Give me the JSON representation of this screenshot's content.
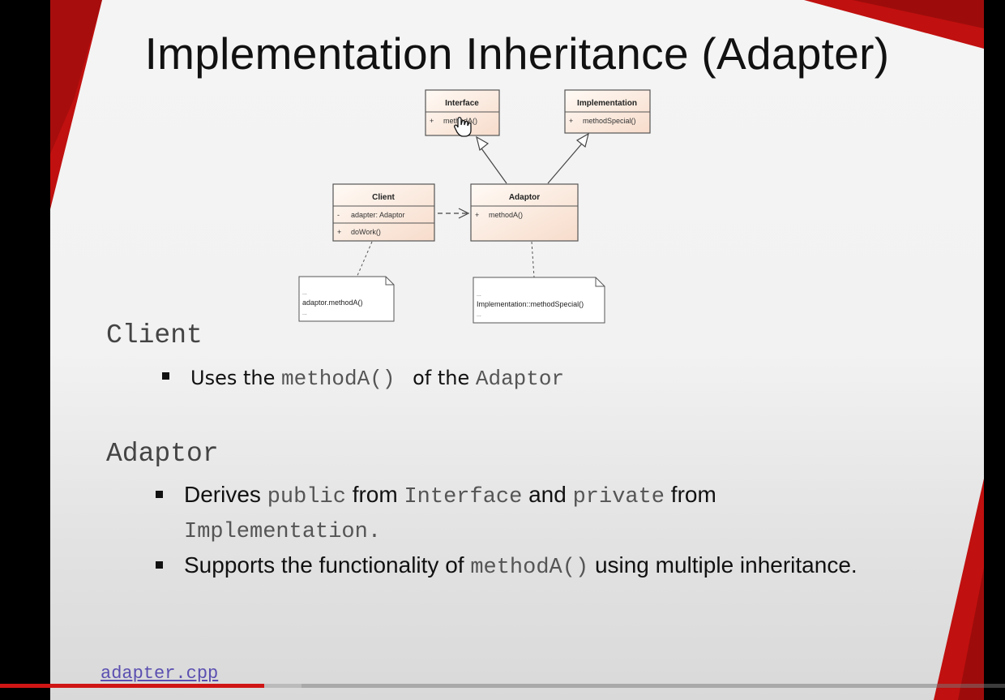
{
  "slide": {
    "title": "Implementation Inheritance (Adapter)",
    "colors": {
      "accent": "#c0100f",
      "text": "#111111",
      "mono": "#555555"
    }
  },
  "diagram": {
    "classes": {
      "interface": {
        "name": "Interface",
        "members": [
          {
            "vis": "+",
            "text": "methodA()"
          }
        ]
      },
      "implementation": {
        "name": "Implementation",
        "members": [
          {
            "vis": "+",
            "text": "methodSpecial()"
          }
        ]
      },
      "client": {
        "name": "Client",
        "attributes": [
          {
            "vis": "-",
            "text": "adapter: Adaptor"
          }
        ],
        "methods": [
          {
            "vis": "+",
            "text": "doWork()"
          }
        ]
      },
      "adaptor": {
        "name": "Adaptor",
        "members": [
          {
            "vis": "+",
            "text": "methodA()"
          }
        ]
      }
    },
    "notes": {
      "client_note": {
        "pre": "...",
        "line": "adaptor.methodA()",
        "post": "..."
      },
      "adaptor_note": {
        "pre": "...",
        "line": "Implementation::methodSpecial()",
        "post": "..."
      }
    },
    "cursor_icon": "hand-pointer-icon"
  },
  "sections": {
    "client": {
      "heading": "Client",
      "bullets": {
        "b1": {
          "t1": "Uses the",
          "c1": "methodA()",
          "t2": "of the",
          "c2": "Adaptor"
        }
      }
    },
    "adaptor": {
      "heading": "Adaptor",
      "bullets": {
        "b1": {
          "t1": "Derives",
          "c1": "public",
          "t2": "from",
          "c2": "Interface",
          "t3": "and",
          "c3": "private",
          "t4": "from",
          "c4": "Implementation",
          "t5": "."
        },
        "b2": {
          "t1": "Supports the functionality of",
          "c1": "methodA()",
          "t2": "using multiple inheritance."
        }
      }
    }
  },
  "link": {
    "label": "adapter.cpp"
  },
  "player": {
    "progress": 0.263,
    "buffered": 0.3
  }
}
